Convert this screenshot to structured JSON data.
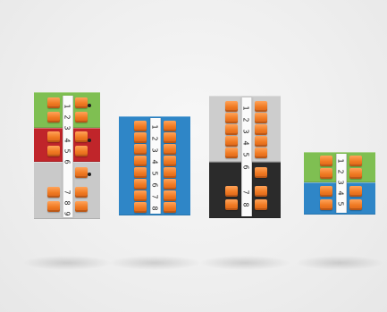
{
  "image": {
    "subject": "modular_terminal_blocks",
    "colors": {
      "background": "#efefef",
      "lever": "#f07a22",
      "green": "#7fbf52",
      "red": "#c0252a",
      "blue": "#2f86c7",
      "grey": "#c9c9c9",
      "black": "#2b2b2b",
      "marker": "#fbfbfb"
    },
    "blocks": [
      {
        "name": "block-1",
        "sections": [
          "green",
          "red",
          "grey"
        ],
        "labels": [
          "1",
          "2",
          "3",
          "4",
          "5",
          "6",
          "7",
          "8",
          "9"
        ]
      },
      {
        "name": "block-2",
        "sections": [
          "blue"
        ],
        "labels": [
          "1",
          "2",
          "3",
          "4",
          "5",
          "6",
          "7",
          "8"
        ]
      },
      {
        "name": "block-3",
        "sections": [
          "grey",
          "black"
        ],
        "labels": [
          "1",
          "2",
          "3",
          "4",
          "5",
          "6",
          "7",
          "8"
        ]
      },
      {
        "name": "block-4",
        "sections": [
          "green",
          "blue"
        ],
        "labels": [
          "1",
          "2",
          "3",
          "4",
          "5"
        ]
      }
    ]
  }
}
